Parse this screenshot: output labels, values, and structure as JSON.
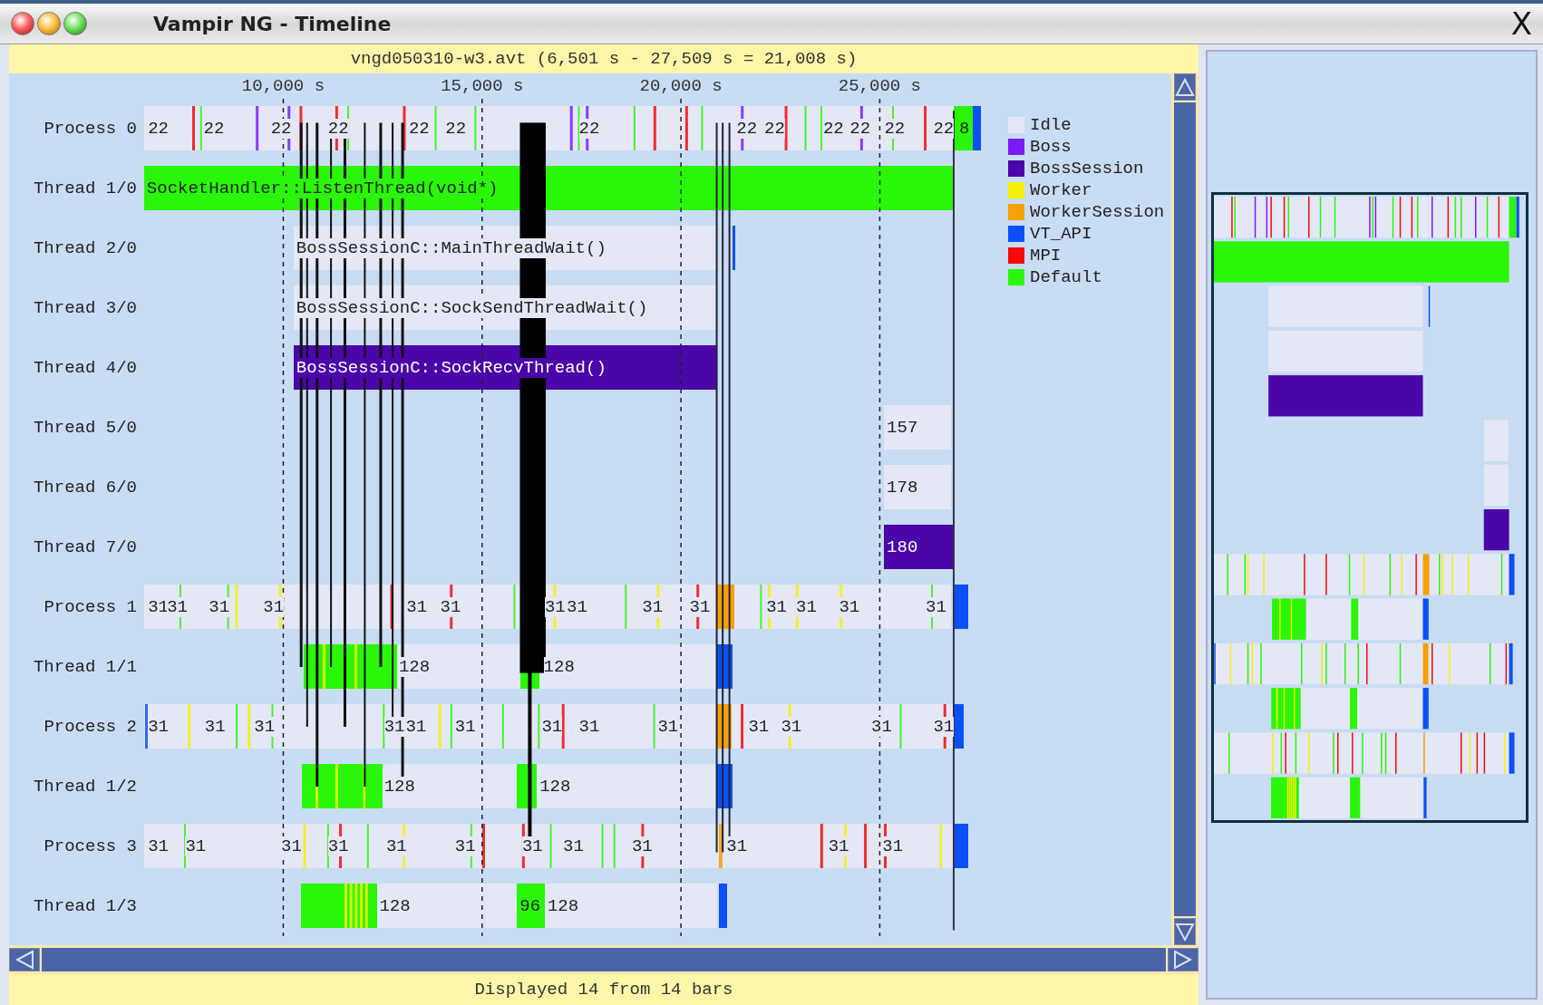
{
  "window": {
    "title": "Vampir NG - Timeline",
    "close": "X"
  },
  "timeline": {
    "file_range": "vngd050310-w3.avt (6,501 s - 27,509 s = 21,008 s)",
    "axis": [
      {
        "label": "10,000 s"
      },
      {
        "label": "15,000 s"
      },
      {
        "label": "20,000 s"
      },
      {
        "label": "25,000 s"
      }
    ],
    "rows": [
      {
        "label": "Process 0",
        "bars": [
          {
            "kind": "idle"
          },
          {
            "kind": "default"
          },
          {
            "kind": "vt_api"
          }
        ],
        "events": [
          {
            "kind": "mpi"
          },
          {
            "kind": "default"
          },
          {
            "kind": "boss"
          },
          {
            "kind": "boss"
          },
          {
            "kind": "mpi"
          },
          {
            "kind": "mpi"
          },
          {
            "kind": "default"
          },
          {
            "kind": "mpi"
          },
          {
            "kind": "default"
          },
          {
            "kind": "default"
          },
          {
            "kind": "boss"
          },
          {
            "kind": "default"
          },
          {
            "kind": "boss"
          },
          {
            "kind": "default"
          },
          {
            "kind": "mpi"
          },
          {
            "kind": "mpi"
          },
          {
            "kind": "default"
          },
          {
            "kind": "boss"
          },
          {
            "kind": "mpi"
          },
          {
            "kind": "default"
          },
          {
            "kind": "default"
          },
          {
            "kind": "boss"
          },
          {
            "kind": "default"
          },
          {
            "kind": "mpi"
          }
        ],
        "texts": [
          {
            "text": "22"
          },
          {
            "text": "22"
          },
          {
            "text": "22"
          },
          {
            "text": "22"
          },
          {
            "text": "22"
          },
          {
            "text": "22"
          },
          {
            "text": "22"
          },
          {
            "text": "22"
          },
          {
            "text": "22"
          },
          {
            "text": "22"
          },
          {
            "text": "22"
          },
          {
            "text": "22"
          },
          {
            "text": "22"
          },
          {
            "text": "8"
          }
        ]
      },
      {
        "label": "Thread 1/0",
        "bars": [
          {
            "kind": "default"
          }
        ],
        "events": [],
        "texts": [
          {
            "text": "SocketHandler::ListenThread(void*)"
          }
        ]
      },
      {
        "label": "Thread 2/0",
        "bars": [
          {
            "kind": "idle"
          },
          {
            "kind": "vt_api"
          }
        ],
        "events": [],
        "texts": [
          {
            "text": "BossSessionC::MainThreadWait()"
          }
        ]
      },
      {
        "label": "Thread 3/0",
        "bars": [
          {
            "kind": "idle"
          }
        ],
        "events": [],
        "texts": [
          {
            "text": "BossSessionC::SockSendThreadWait()"
          }
        ]
      },
      {
        "label": "Thread 4/0",
        "bars": [
          {
            "kind": "boss_session"
          }
        ],
        "events": [],
        "texts": [
          {
            "text": "BossSessionC::SockRecvThread()"
          }
        ]
      },
      {
        "label": "Thread 5/0",
        "bars": [
          {
            "kind": "idle"
          }
        ],
        "events": [],
        "texts": [
          {
            "text": "157"
          }
        ]
      },
      {
        "label": "Thread 6/0",
        "bars": [
          {
            "kind": "idle"
          }
        ],
        "events": [],
        "texts": [
          {
            "text": "178"
          }
        ]
      },
      {
        "label": "Thread 7/0",
        "bars": [
          {
            "kind": "boss_session"
          }
        ],
        "events": [],
        "texts": [
          {
            "text": "180"
          }
        ]
      },
      {
        "label": "Process 1",
        "bars": [
          {
            "kind": "idle"
          },
          {
            "kind": "worker_session"
          },
          {
            "kind": "vt_api"
          }
        ],
        "events": [
          {
            "kind": "default"
          },
          {
            "kind": "default"
          },
          {
            "kind": "worker"
          },
          {
            "kind": "worker"
          },
          {
            "kind": "mpi"
          },
          {
            "kind": "mpi"
          },
          {
            "kind": "default"
          },
          {
            "kind": "worker"
          },
          {
            "kind": "default"
          },
          {
            "kind": "worker"
          },
          {
            "kind": "mpi"
          },
          {
            "kind": "default"
          },
          {
            "kind": "worker"
          },
          {
            "kind": "worker"
          },
          {
            "kind": "worker"
          },
          {
            "kind": "default"
          }
        ],
        "texts": [
          {
            "text": "31"
          },
          {
            "text": "31"
          },
          {
            "text": "31"
          },
          {
            "text": "31"
          },
          {
            "text": "31"
          },
          {
            "text": "31"
          },
          {
            "text": "31"
          },
          {
            "text": "31"
          },
          {
            "text": "31"
          },
          {
            "text": "31"
          },
          {
            "text": "31"
          },
          {
            "text": "31"
          },
          {
            "text": "31"
          },
          {
            "text": "31"
          }
        ]
      },
      {
        "label": "Thread 1/1",
        "bars": [
          {
            "kind": "default"
          },
          {
            "kind": "idle"
          },
          {
            "kind": "default"
          },
          {
            "kind": "vt_api"
          }
        ],
        "events": [
          {
            "kind": "worker"
          },
          {
            "kind": "worker"
          }
        ],
        "texts": [
          {
            "text": "128"
          },
          {
            "text": "128"
          }
        ]
      },
      {
        "label": "Process 2",
        "bars": [
          {
            "kind": "idle"
          },
          {
            "kind": "worker_session"
          },
          {
            "kind": "vt_api"
          }
        ],
        "events": [
          {
            "kind": "vt_api"
          },
          {
            "kind": "worker"
          },
          {
            "kind": "default"
          },
          {
            "kind": "worker"
          },
          {
            "kind": "default"
          },
          {
            "kind": "default"
          },
          {
            "kind": "worker"
          },
          {
            "kind": "default"
          },
          {
            "kind": "default"
          },
          {
            "kind": "default"
          },
          {
            "kind": "mpi"
          },
          {
            "kind": "default"
          },
          {
            "kind": "mpi"
          },
          {
            "kind": "worker"
          },
          {
            "kind": "default"
          },
          {
            "kind": "mpi"
          }
        ],
        "texts": [
          {
            "text": "31"
          },
          {
            "text": "31"
          },
          {
            "text": "31"
          },
          {
            "text": "31"
          },
          {
            "text": "31"
          },
          {
            "text": "31"
          },
          {
            "text": "31"
          },
          {
            "text": "31"
          },
          {
            "text": "31"
          },
          {
            "text": "31"
          },
          {
            "text": "31"
          },
          {
            "text": "31"
          },
          {
            "text": "31"
          }
        ]
      },
      {
        "label": "Thread 1/2",
        "bars": [
          {
            "kind": "default"
          },
          {
            "kind": "idle"
          },
          {
            "kind": "default"
          },
          {
            "kind": "vt_api"
          }
        ],
        "events": [
          {
            "kind": "worker"
          },
          {
            "kind": "worker"
          },
          {
            "kind": "worker"
          }
        ],
        "texts": [
          {
            "text": "128"
          },
          {
            "text": "128"
          }
        ]
      },
      {
        "label": "Process 3",
        "bars": [
          {
            "kind": "idle"
          },
          {
            "kind": "vt_api"
          }
        ],
        "events": [
          {
            "kind": "default"
          },
          {
            "kind": "worker"
          },
          {
            "kind": "default"
          },
          {
            "kind": "mpi"
          },
          {
            "kind": "default"
          },
          {
            "kind": "worker"
          },
          {
            "kind": "default"
          },
          {
            "kind": "mpi"
          },
          {
            "kind": "mpi"
          },
          {
            "kind": "default"
          },
          {
            "kind": "default"
          },
          {
            "kind": "default"
          },
          {
            "kind": "mpi"
          },
          {
            "kind": "worker_session"
          },
          {
            "kind": "mpi"
          },
          {
            "kind": "worker"
          },
          {
            "kind": "mpi"
          },
          {
            "kind": "mpi"
          },
          {
            "kind": "worker"
          }
        ],
        "texts": [
          {
            "text": "31"
          },
          {
            "text": "31"
          },
          {
            "text": "31"
          },
          {
            "text": "31"
          },
          {
            "text": "31"
          },
          {
            "text": "31"
          },
          {
            "text": "31"
          },
          {
            "text": "31"
          },
          {
            "text": "31"
          },
          {
            "text": "31"
          },
          {
            "text": "31"
          },
          {
            "text": "31"
          }
        ]
      },
      {
        "label": "Thread 1/3",
        "bars": [
          {
            "kind": "default"
          },
          {
            "kind": "idle"
          },
          {
            "kind": "default"
          },
          {
            "kind": "vt_api"
          }
        ],
        "events": [
          {
            "kind": "worker"
          },
          {
            "kind": "worker"
          },
          {
            "kind": "worker"
          },
          {
            "kind": "worker"
          },
          {
            "kind": "worker"
          }
        ],
        "texts": [
          {
            "text": "128"
          },
          {
            "text": "96"
          },
          {
            "text": "128"
          }
        ]
      }
    ],
    "legend": [
      {
        "label": "Idle",
        "kind": "idle",
        "color": "#e4e8f6"
      },
      {
        "label": "Boss",
        "kind": "boss",
        "color": "#7a1cf6"
      },
      {
        "label": "BossSession",
        "kind": "boss_session",
        "color": "#4a06a8"
      },
      {
        "label": "Worker",
        "kind": "worker",
        "color": "#f6f00a"
      },
      {
        "label": "WorkerSession",
        "kind": "worker_session",
        "color": "#f6a00a"
      },
      {
        "label": "VT_API",
        "kind": "vt_api",
        "color": "#0a50f6"
      },
      {
        "label": "MPI",
        "kind": "mpi",
        "color": "#f60a0a"
      },
      {
        "label": "Default",
        "kind": "default",
        "color": "#2af60a"
      }
    ]
  },
  "status_bar": "Displayed 14 from 14 bars"
}
